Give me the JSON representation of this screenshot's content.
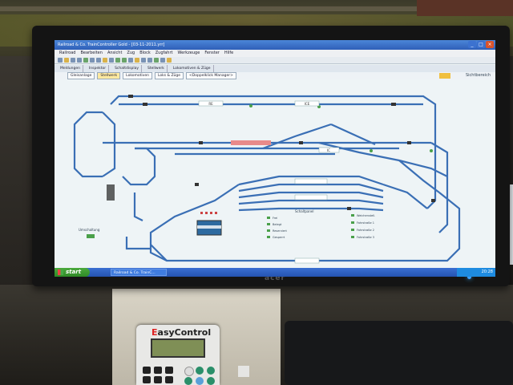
{
  "window": {
    "title": "Railroad & Co. TrainController Gold - [03-11-2011.yrr]",
    "controls": {
      "minimize": "_",
      "maximize": "□",
      "close": "×"
    }
  },
  "menu": [
    "Railroad",
    "Bearbeiten",
    "Ansicht",
    "Zug",
    "Block",
    "Zugfahrt",
    "Werkzeuge",
    "Fenster",
    "Hilfe"
  ],
  "toolbar_row2": [
    "Meldungen",
    "Inspektor",
    "Schaltdisplay",
    "Stellwerk",
    "Lokomotiven & Züge"
  ],
  "sub_tabs": [
    {
      "label": "Gleisanlage",
      "active": false
    },
    {
      "label": "Stellwerk",
      "active": true
    },
    {
      "label": "Lokomotiven",
      "active": false
    },
    {
      "label": "Loks & Züge",
      "active": false
    },
    {
      "label": "<Doppelklick Manager>",
      "active": false
    }
  ],
  "view_label": "Sichtbereich",
  "track_labels": [
    "RE",
    "ICE",
    "IC"
  ],
  "panel_legend": {
    "title": "Schaltpanel",
    "items": [
      "Frei",
      "Belegt",
      "Reserviert",
      "Gesperrt"
    ]
  },
  "panel_right": {
    "items": [
      "Weichenstell.",
      "Fahrstraße 1",
      "Fahrstraße 2",
      "Fahrstraße 3"
    ]
  },
  "left_note": "Umschaltung",
  "taskbar": {
    "start_label": "start",
    "task_item": "Railroad & Co. TrainC...",
    "clock": "20:28"
  },
  "monitor_brand": "acer",
  "device": {
    "brand_e": "E",
    "brand_rest": "asyControl"
  },
  "colors": {
    "track": "#3a6fb5",
    "occupied": "#e88a8a",
    "background": "#eef4f6",
    "taskbar": "#2453b0",
    "start": "#3c9a31"
  }
}
